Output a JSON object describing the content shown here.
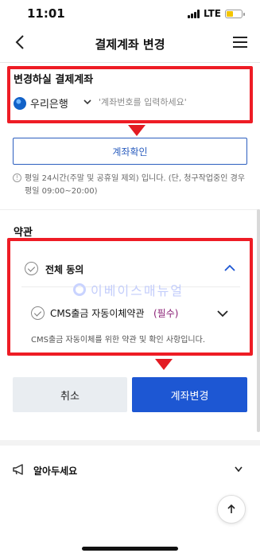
{
  "status_bar": {
    "time": "11:01",
    "network": "LTE",
    "battery_level": 0.45
  },
  "header": {
    "title": "결제계좌 변경",
    "back_icon": "back-arrow-icon",
    "menu_icon": "hamburger-menu-icon"
  },
  "account_section": {
    "label": "변경하실 결제계좌",
    "bank_name": "우리은행",
    "bank_icon": "woori-bank-logo-icon",
    "account_placeholder": "'계좌번호를 입력하세요'",
    "verify_button": "계좌확인"
  },
  "notice": {
    "icon": "info-icon",
    "text": "평일 24시간(주말 및 공휴일 제외) 입니다. (단, 청구작업중인 경우 평일 09:00~20:00)"
  },
  "terms": {
    "heading": "약관",
    "agree_all": "전체 동의",
    "items": [
      {
        "label": "CMS출금 자동이체약관",
        "required_tag": "(필수)",
        "description": "CMS출금 자동이체를 위한 약관 및 확인 사항입니다."
      }
    ]
  },
  "watermark": {
    "text": "이베이스매뉴얼"
  },
  "actions": {
    "cancel": "취소",
    "change": "계좌변경"
  },
  "info_row": {
    "label": "알아두세요",
    "icon": "megaphone-icon"
  },
  "colors": {
    "primary": "#1d57d3",
    "highlight": "#ee1c25",
    "required": "#8a1f75"
  }
}
